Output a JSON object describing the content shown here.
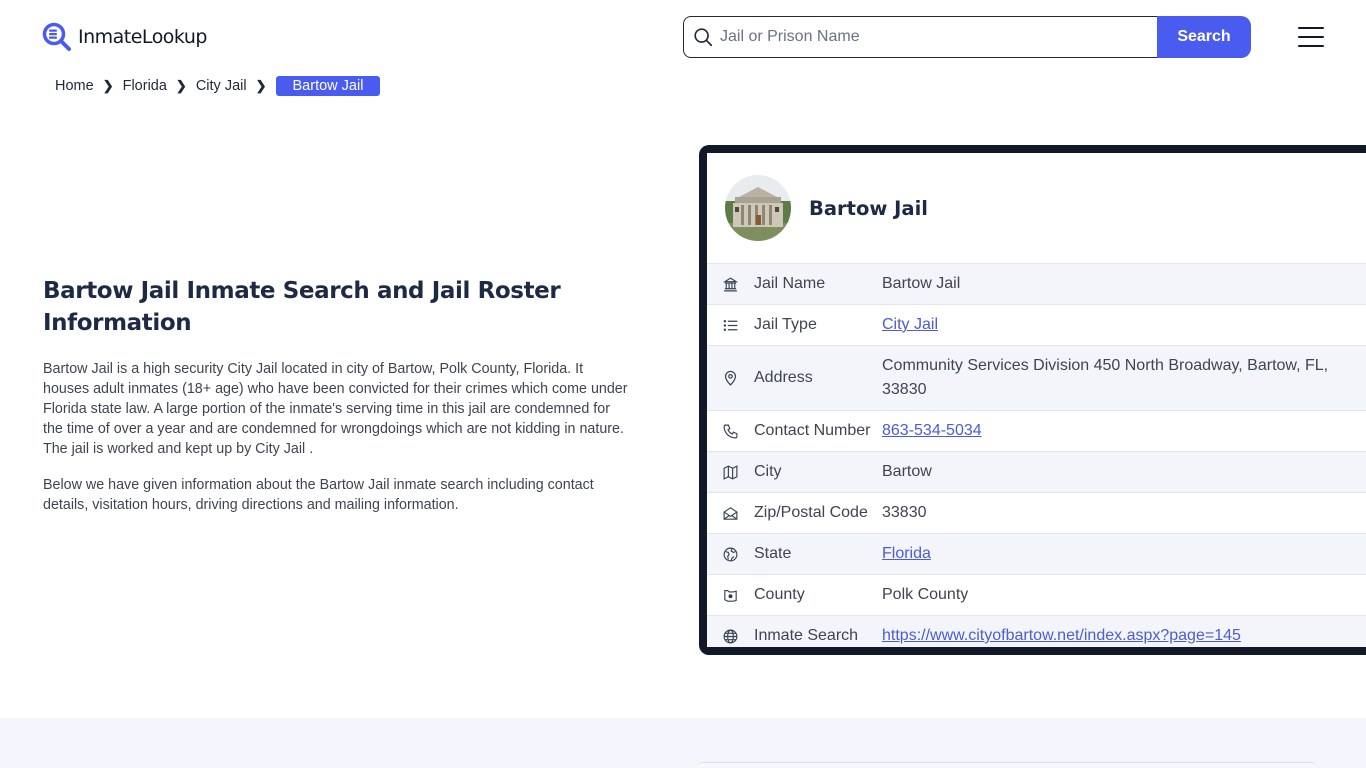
{
  "header": {
    "logo_text": "InmateLookup",
    "search_placeholder": "Jail or Prison Name",
    "search_value": "",
    "search_button": "Search",
    "menu_icon": "hamburger-menu-icon"
  },
  "breadcrumb": {
    "items": [
      "Home",
      "Florida",
      "City Jail"
    ],
    "current": "Bartow Jail"
  },
  "intro": {
    "title": "Bartow Jail Inmate Search and Jail Roster Information",
    "paragraph1": "Bartow Jail is a high security City Jail located in city of Bartow, Polk County, Florida. It houses adult inmates (18+ age) who have been convicted for their crimes which come under Florida state law. A large portion of the inmate's serving time in this jail are condemned for the time of over a year and are condemned for wrongdoings which are not kidding in nature. The jail is worked and kept up by City Jail .",
    "paragraph2": "Below we have given information about the Bartow Jail inmate search including contact details, visitation hours, driving directions and mailing information."
  },
  "card": {
    "title": "Bartow Jail",
    "rows": [
      {
        "icon": "building-icon",
        "label": "Jail Name",
        "value": "Bartow Jail",
        "link": false
      },
      {
        "icon": "list-icon",
        "label": "Jail Type",
        "value": "City Jail",
        "link": true
      },
      {
        "icon": "map-pin-icon",
        "label": "Address",
        "value": "Community Services Division 450 North Broadway, Bartow, FL, 33830",
        "link": false
      },
      {
        "icon": "phone-icon",
        "label": "Contact Number",
        "value": "863-534-5034",
        "link": true
      },
      {
        "icon": "map-icon",
        "label": "City",
        "value": "Bartow",
        "link": false
      },
      {
        "icon": "mail-open-icon",
        "label": "Zip/Postal Code",
        "value": "33830",
        "link": false
      },
      {
        "icon": "globe-region-icon",
        "label": "State",
        "value": "Florida",
        "link": true
      },
      {
        "icon": "county-icon",
        "label": "County",
        "value": "Polk County",
        "link": false
      },
      {
        "icon": "globe-icon",
        "label": "Inmate Search",
        "value": "https://www.cityofbartow.net/index.aspx?page=145",
        "link": true
      }
    ]
  },
  "colors": {
    "accent": "#4a5cf0",
    "card_border": "#111827",
    "heading": "#1e2a45",
    "link": "#4a5cd6"
  }
}
